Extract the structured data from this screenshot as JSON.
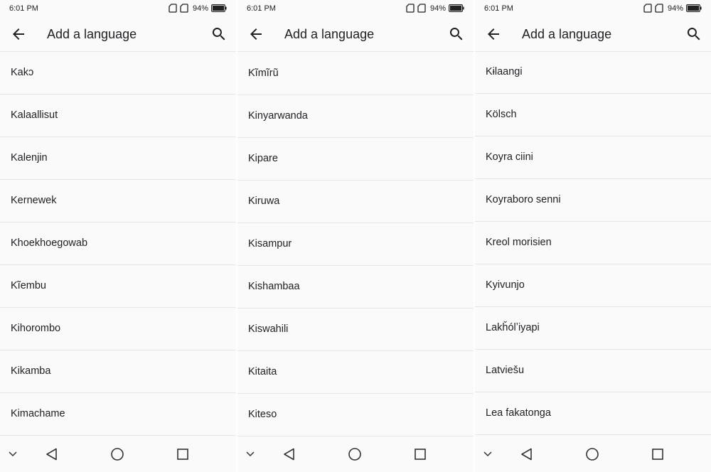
{
  "screens": [
    {
      "status": {
        "time": "6:01 PM",
        "battery": "94%"
      },
      "title": "Add a language",
      "languages": [
        "Kakɔ",
        "Kalaallisut",
        "Kalenjin",
        "Kernewek",
        "Khoekhoegowab",
        "Kĩembu",
        "Kihorombo",
        "Kikamba",
        "Kimachame"
      ]
    },
    {
      "status": {
        "time": "6:01 PM",
        "battery": "94%"
      },
      "title": "Add a language",
      "languages": [
        "Kĩmĩrũ",
        "Kinyarwanda",
        "Kipare",
        "Kiruwa",
        "Kisampur",
        "Kishambaa",
        "Kiswahili",
        "Kitaita",
        "Kiteso"
      ]
    },
    {
      "status": {
        "time": "6:01 PM",
        "battery": "94%"
      },
      "title": "Add a language",
      "languages": [
        "Kɨlaangi",
        "Kölsch",
        "Koyra ciini",
        "Koyraboro senni",
        "Kreol morisien",
        "Kyivunjo",
        "Lakȟólʼiyapi",
        "Latviešu",
        "Lea fakatonga"
      ]
    }
  ],
  "icons": {
    "back": "arrow-back-icon",
    "search": "search-icon",
    "sim": "sim-card-icon",
    "battery": "battery-icon",
    "nav_chevron": "chevron-down-icon",
    "nav_back": "triangle-back-icon",
    "nav_home": "circle-home-icon",
    "nav_recents": "square-recents-icon"
  }
}
